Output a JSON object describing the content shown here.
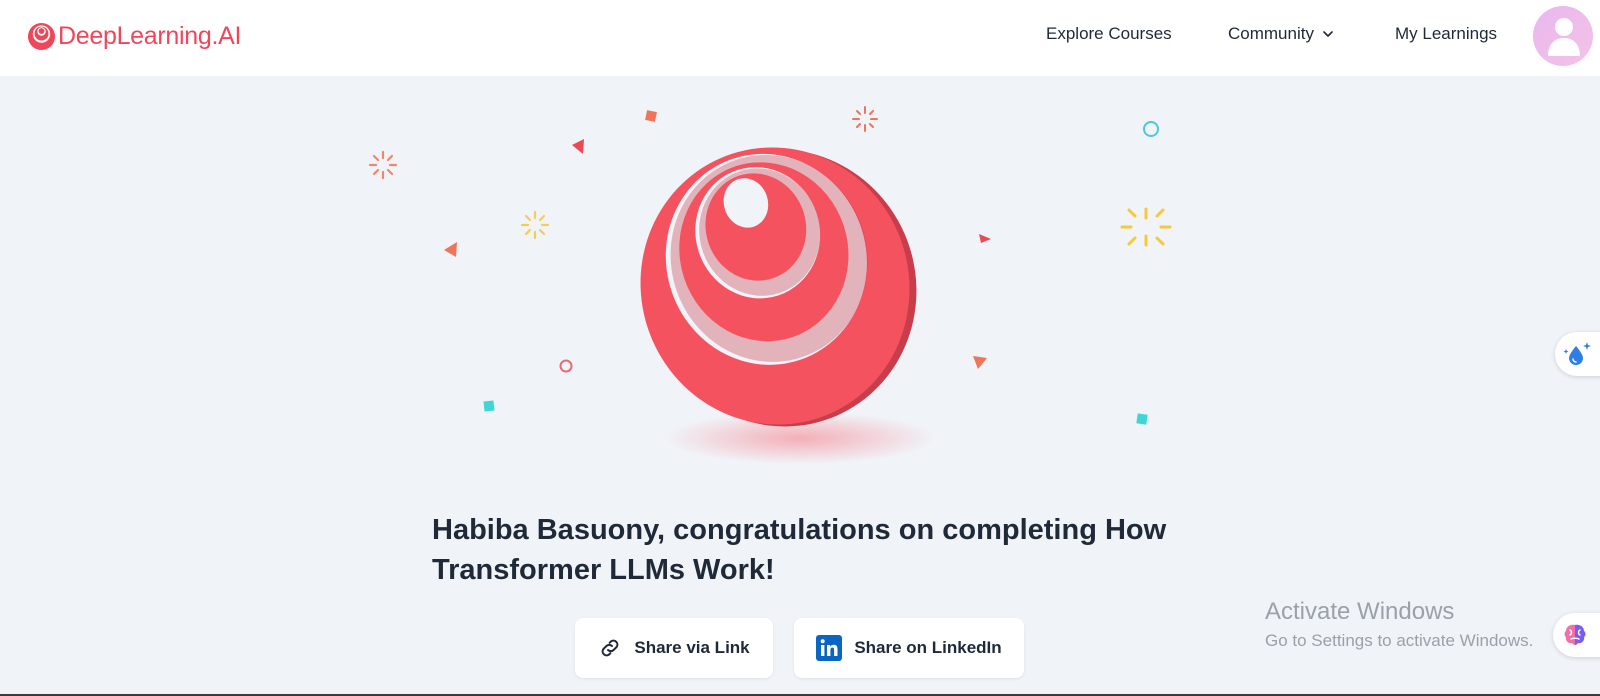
{
  "header": {
    "logo_text": "DeepLearning.AI",
    "nav": {
      "explore": "Explore Courses",
      "community": "Community",
      "my_learnings": "My Learnings"
    },
    "avatar_icon": "user-avatar-icon"
  },
  "main": {
    "title": "Habiba Basuony, congratulations on completing How Transformer LLMs Work!",
    "share_link_label": "Share via Link",
    "share_linkedin_label": "Share on LinkedIn",
    "share_link_icon": "link-icon",
    "share_linkedin_icon": "linkedin-icon"
  },
  "watermark": {
    "line1": "Activate Windows",
    "line2": "Go to Settings to activate Windows."
  },
  "colors": {
    "brand": "#f0465a",
    "background": "#f0f3f8",
    "linkedin": "#0a66c2"
  }
}
